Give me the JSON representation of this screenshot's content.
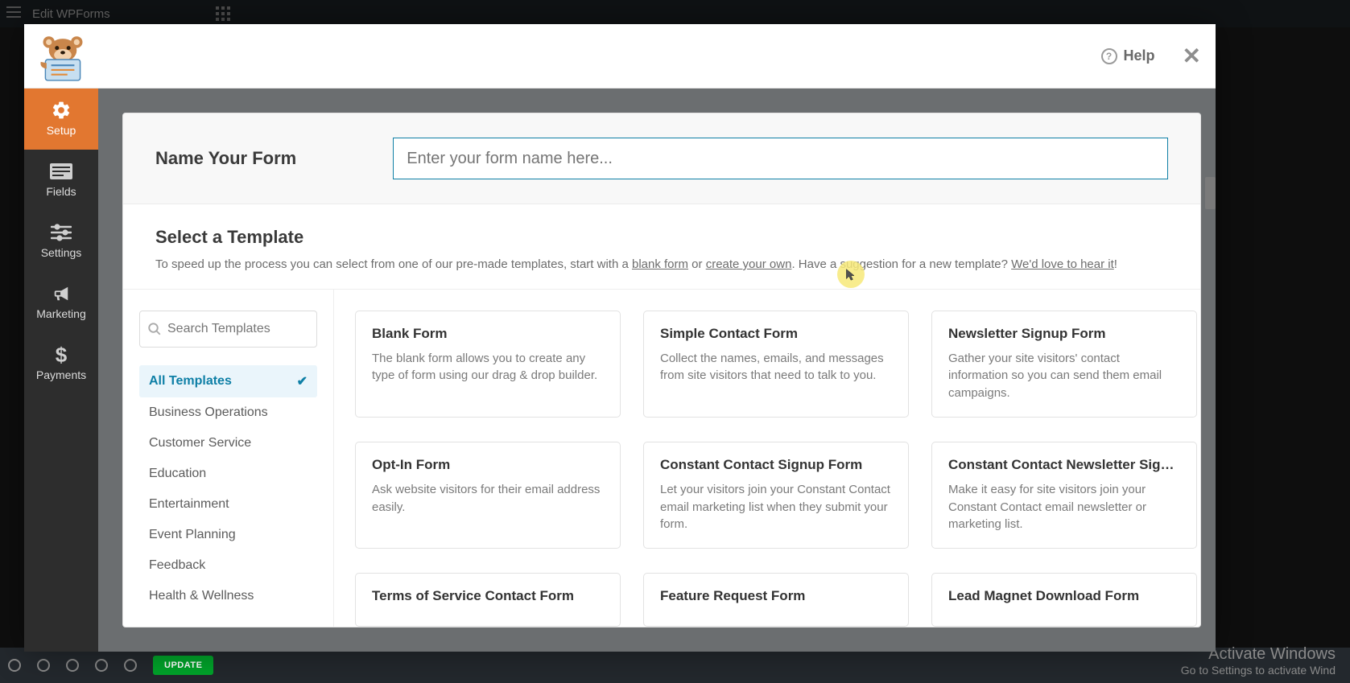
{
  "wp": {
    "title": "Edit WPForms",
    "update_btn": "UPDATE",
    "activate_t1": "Activate Windows",
    "activate_t2": "Go to Settings to activate Wind"
  },
  "hdr": {
    "help": "Help"
  },
  "nav": {
    "items": [
      {
        "key": "setup",
        "label": "Setup",
        "active": true
      },
      {
        "key": "fields",
        "label": "Fields"
      },
      {
        "key": "settings",
        "label": "Settings"
      },
      {
        "key": "marketing",
        "label": "Marketing"
      },
      {
        "key": "payments",
        "label": "Payments"
      }
    ]
  },
  "form": {
    "name_label": "Name Your Form",
    "name_placeholder": "Enter your form name here..."
  },
  "template": {
    "title": "Select a Template",
    "desc_start": "To speed up the process you can select from one of our pre-made templates, start with a ",
    "blank_link": "blank form",
    "or": " or ",
    "create_link": "create your own",
    "desc_mid": ". Have a suggestion for a new template? ",
    "hear_link": "We'd love to hear it",
    "desc_end": "!"
  },
  "search": {
    "placeholder": "Search Templates"
  },
  "categories": [
    "All Templates",
    "Business Operations",
    "Customer Service",
    "Education",
    "Entertainment",
    "Event Planning",
    "Feedback",
    "Health & Wellness"
  ],
  "cards": [
    {
      "title": "Blank Form",
      "desc": "The blank form allows you to create any type of form using our drag & drop builder."
    },
    {
      "title": "Simple Contact Form",
      "desc": "Collect the names, emails, and messages from site visitors that need to talk to you."
    },
    {
      "title": "Newsletter Signup Form",
      "desc": "Gather your site visitors' contact information so you can send them email campaigns."
    },
    {
      "title": "Opt-In Form",
      "desc": "Ask website visitors for their email address easily."
    },
    {
      "title": "Constant Contact Signup Form",
      "desc": "Let your visitors join your Constant Contact email marketing list when they submit your form."
    },
    {
      "title": "Constant Contact Newsletter Sign...",
      "desc": "Make it easy for site visitors join your Constant Contact email newsletter or marketing list."
    },
    {
      "title": "Terms of Service Contact Form",
      "desc": ""
    },
    {
      "title": "Feature Request Form",
      "desc": ""
    },
    {
      "title": "Lead Magnet Download Form",
      "desc": ""
    }
  ]
}
